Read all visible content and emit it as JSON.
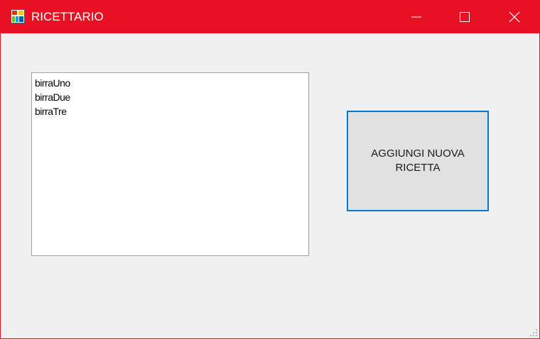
{
  "window": {
    "title": "RICETTARIO",
    "title_bar_color": "#e81123",
    "icon": "app-icon"
  },
  "controls": {
    "minimize_icon": "minimize-icon",
    "maximize_icon": "maximize-icon",
    "close_icon": "close-icon"
  },
  "recipe_list": {
    "items": [
      "birraUno",
      "birraDue",
      "birraTre"
    ]
  },
  "add_recipe_button": {
    "label": "AGGIUNGI NUOVA RICETTA",
    "border_color": "#0078d7"
  }
}
